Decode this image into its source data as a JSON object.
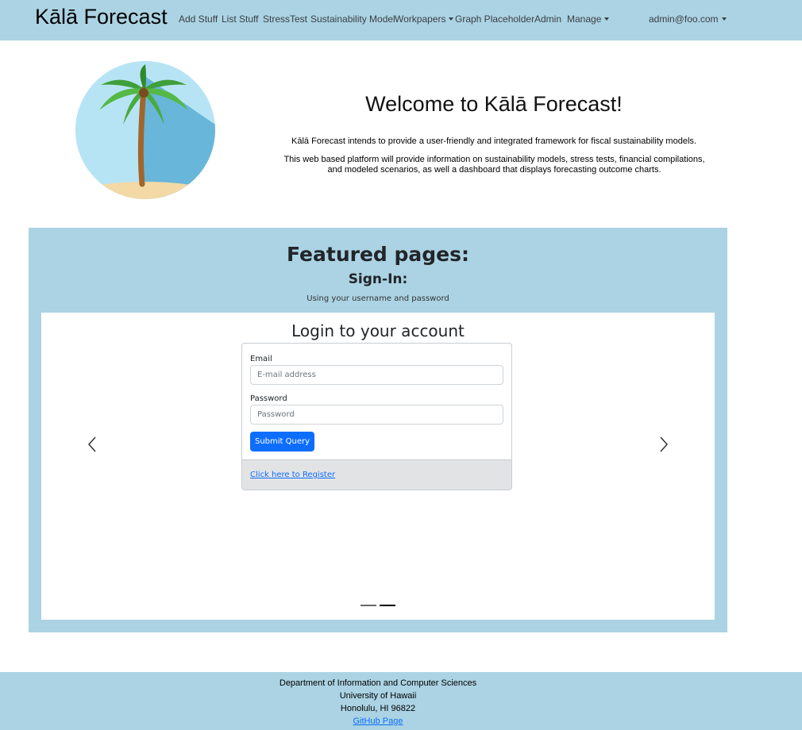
{
  "navbar": {
    "brand": "Kālā Forecast",
    "items": [
      {
        "label": "Add Stuff"
      },
      {
        "label": "List Stuff"
      },
      {
        "label": "StressTest"
      },
      {
        "label": "Sustainability Model"
      },
      {
        "label": "Workpapers"
      },
      {
        "label": "Graph Placeholder"
      },
      {
        "label": "Admin"
      },
      {
        "label": "Manage"
      }
    ],
    "user": "admin@foo.com"
  },
  "hero": {
    "image": "palm-tree-icon",
    "title": "Welcome to Kālā Forecast!",
    "p1": "Kālā Forecast intends to provide a user-friendly and integrated framework for fiscal sustainability models.",
    "p2": "This web based platform will provide information on sustainability models, stress tests, financial compilations, and modeled scenarios, as well a dashboard that displays forecasting outcome charts."
  },
  "featured": {
    "title": "Featured pages:",
    "subtitle": "Sign-In:",
    "note": "Using your username and password",
    "login": {
      "title": "Login to your account",
      "email_label": "Email",
      "email_placeholder": "E-mail address",
      "password_label": "Password",
      "password_placeholder": "Password",
      "submit": "Submit Query",
      "register": "Click here to Register"
    },
    "active_slide": 2,
    "slide_count": 2
  },
  "footer": {
    "line1": "Department of Information and Computer Sciences",
    "line2": "University of Hawaii",
    "line3": "Honolulu, HI 96822",
    "link": "GitHub Page"
  },
  "colors": {
    "theme": "#abd3e3",
    "primary": "#0d6efd",
    "card_footer": "#e2e3e5"
  }
}
